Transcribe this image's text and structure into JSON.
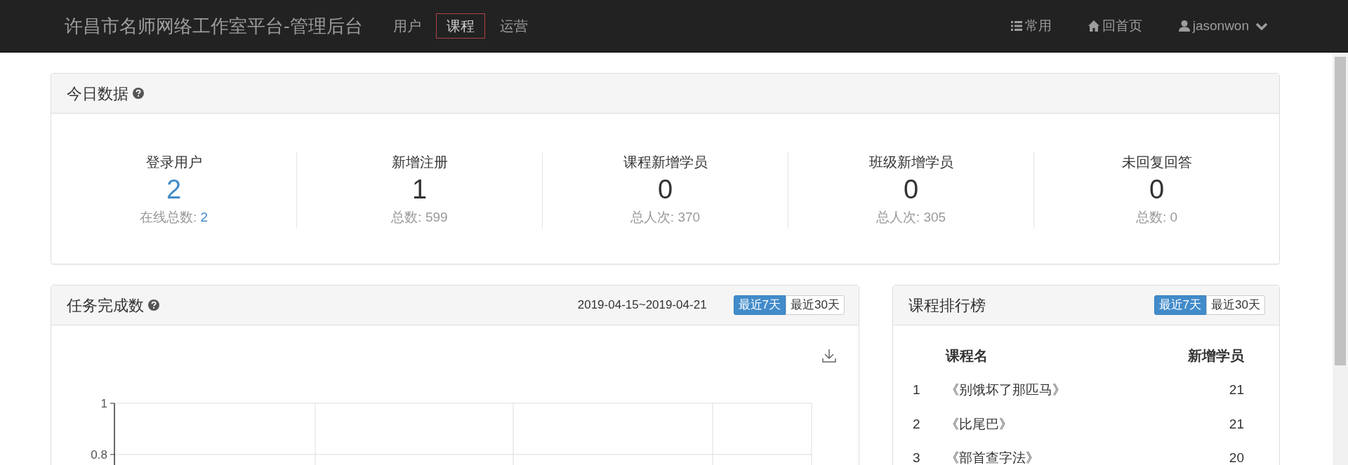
{
  "navbar": {
    "brand": "许昌市名师网络工作室平台-管理后台",
    "menu": [
      {
        "label": "用户",
        "selected": false
      },
      {
        "label": "课程",
        "selected": true
      },
      {
        "label": "运营",
        "selected": false
      }
    ],
    "right_menu": [
      {
        "kind": "list",
        "label": "常用"
      },
      {
        "kind": "home",
        "label": "回首页"
      },
      {
        "kind": "user",
        "label": "jasonwon"
      }
    ]
  },
  "today_panel": {
    "title": "今日数据",
    "stats": [
      {
        "label": "登录用户",
        "value": "2",
        "sub_label": "在线总数:",
        "sub_value": "2",
        "highlight": true
      },
      {
        "label": "新增注册",
        "value": "1",
        "sub_label": "总数:",
        "sub_value": "599",
        "highlight": false
      },
      {
        "label": "课程新增学员",
        "value": "0",
        "sub_label": "总人次:",
        "sub_value": "370",
        "highlight": false
      },
      {
        "label": "班级新增学员",
        "value": "0",
        "sub_label": "总人次:",
        "sub_value": "305",
        "highlight": false
      },
      {
        "label": "未回复回答",
        "value": "0",
        "sub_label": "总数:",
        "sub_value": "0",
        "highlight": false
      }
    ]
  },
  "task_panel": {
    "title": "任务完成数",
    "date_range": "2019-04-15~2019-04-21",
    "ranges": [
      {
        "label": "最近7天",
        "selected": true
      },
      {
        "label": "最近30天",
        "selected": false
      }
    ],
    "chart_axis_labels": [
      "1",
      "0.8"
    ]
  },
  "ranking_panel": {
    "title": "课程排行榜",
    "ranges": [
      {
        "label": "最近7天",
        "selected": true
      },
      {
        "label": "最近30天",
        "selected": false
      }
    ],
    "table": {
      "columns": [
        "课程名",
        "新增学员"
      ],
      "rows": [
        {
          "rank": "1",
          "name": "《别饿坏了那匹马》",
          "count": "21"
        },
        {
          "rank": "2",
          "name": "《比尾巴》",
          "count": "21"
        },
        {
          "rank": "3",
          "name": "《部首查字法》",
          "count": "20"
        }
      ]
    }
  }
}
